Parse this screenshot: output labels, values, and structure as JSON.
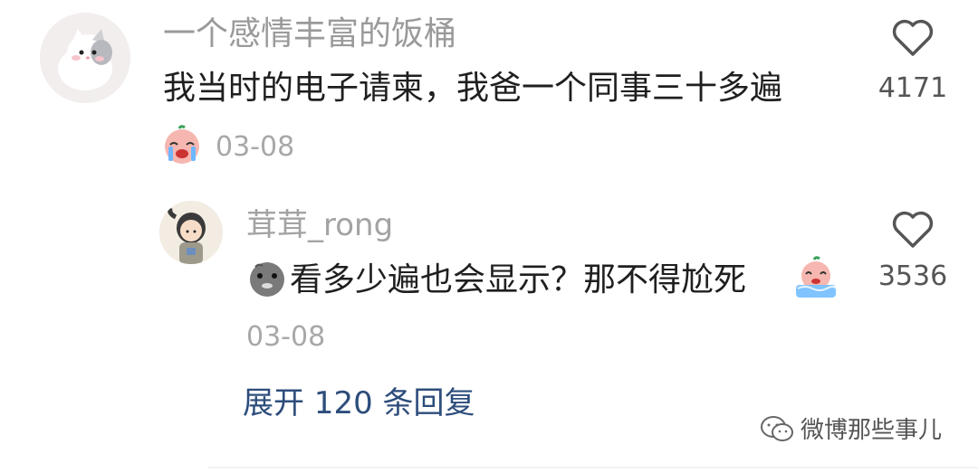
{
  "comments": [
    {
      "username": "一个感情丰富的饭桶",
      "text": "我当时的电子请柬，我爸一个同事三十多遍",
      "date": "03-08",
      "likes": "4171",
      "emoji_prefix": "crying-face-sticker",
      "avatar": "cat-avatar"
    }
  ],
  "replies": [
    {
      "username": "茸茸_rong",
      "text": "看多少遍也会显示？那不得尬死",
      "date": "03-08",
      "likes": "3536",
      "emoji_prefix": "gray-blob-sticker",
      "emoji_suffix": "crying-peach-sticker",
      "avatar": "girl-avatar"
    }
  ],
  "expand_replies": "展开 120 条回复",
  "watermark": "微博那些事儿",
  "colors": {
    "username": "#9a9a9a",
    "text": "#1f1f1f",
    "date": "#a8a8a8",
    "link": "#2d4d7b"
  }
}
